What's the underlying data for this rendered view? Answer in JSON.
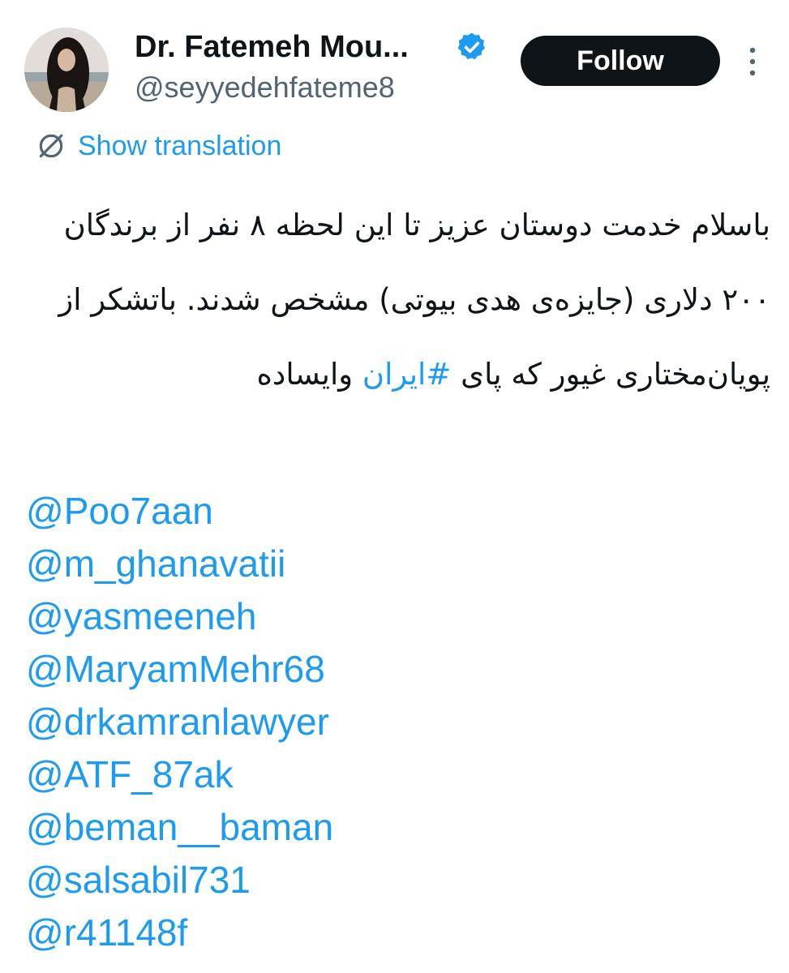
{
  "author": {
    "display_name": "Dr. Fatemeh Mou...",
    "handle": "@seyyedehfateme8",
    "verified": true
  },
  "follow_label": "Follow",
  "translation_label": "Show translation",
  "tweet": {
    "text": "باسلام خدمت دوستان عزیز تا این لحظه ۸ نفر از برندگان ۲۰۰ دلاری (جایزه‌ی هدی بیوتی) مشخص شدند. باتشکر از پویان‌مختاری غیور که پای",
    "hashtag": "#ایران",
    "text_end": "وایساده"
  },
  "mentions": [
    "@Poo7aan",
    "@m_ghanavatii",
    "@yasmeeneh",
    "@MaryamMehr68",
    "@drkamranlawyer",
    "@ATF_87ak",
    "@beman__baman",
    "@salsabil731",
    "@r41148f"
  ],
  "colors": {
    "link": "#1d9bf0",
    "text": "#0f1419",
    "secondary": "#536471",
    "button_bg": "#0f1419"
  },
  "icons": {
    "verified": "verified-badge-icon",
    "more": "more-vertical-icon",
    "translate": "translate-globe-icon"
  }
}
